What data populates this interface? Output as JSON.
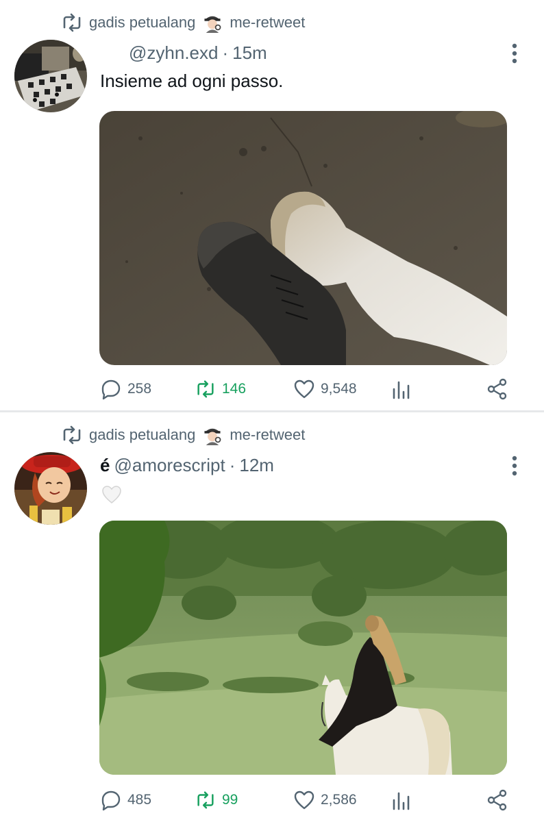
{
  "tweets": [
    {
      "retweeted_by": "gadis petualang",
      "retweet_action": "me-retweet",
      "display_name": "",
      "handle": "@zyhn.exd",
      "time": "15m",
      "text": "Insieme ad ogni passo.",
      "media": "boot-and-hoof-photo",
      "replies": "258",
      "retweets": "146",
      "likes": "9,548",
      "retweeted_by_me": true
    },
    {
      "retweeted_by": "gadis petualang",
      "retweet_action": "me-retweet",
      "display_name": "é",
      "handle": "@amorescript",
      "time": "12m",
      "text": "🤍",
      "media": "rider-on-white-horse-photo",
      "replies": "485",
      "retweets": "99",
      "likes": "2,586",
      "retweeted_by_me": true
    }
  ],
  "colors": {
    "muted": "#536471",
    "retweet_green": "#17a05e",
    "text": "#0f1419"
  }
}
